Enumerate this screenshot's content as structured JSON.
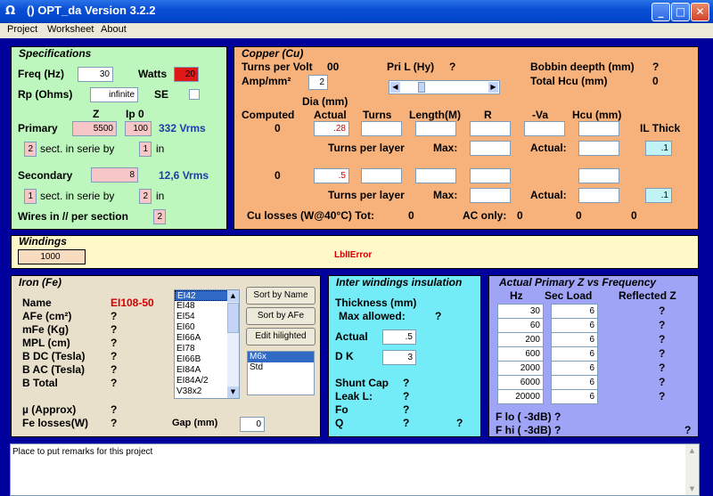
{
  "window": {
    "title": "() OPT_da Version 3.2.2"
  },
  "menu": [
    "Project",
    "Worksheet",
    "About"
  ],
  "spec": {
    "title": "Specifications",
    "freq_label": "Freq (Hz)",
    "freq": "30",
    "watts_label": "Watts",
    "watts": "20",
    "rp_label": "Rp (Ohms)",
    "rp": "infinite",
    "se_label": "SE",
    "z_label": "Z",
    "ip_label": "Ip 0",
    "primary_label": "Primary",
    "primary_z": "5500",
    "primary_ip": "100",
    "primary_vrms": "332 Vrms",
    "sect1": "2",
    "sect_in_serie": "sect. in serie by",
    "by1": "1",
    "in_label": "in",
    "secondary_label": "Secondary",
    "secondary_z": "8",
    "secondary_vrms": "12,6 Vrms",
    "sect2": "1",
    "by2": "2",
    "wires_label": "Wires in // per section",
    "wires": "2"
  },
  "copper": {
    "title": "Copper (Cu)",
    "turns_per_volt": "Turns per Volt",
    "turns_per_volt_val": "00",
    "amp_mm": "Amp/mm²",
    "amp_mm_val": "2",
    "pri_l": "Pri L (Hy)",
    "pri_l_val": "?",
    "bobbin": "Bobbin deepth (mm)",
    "bobbin_val": "?",
    "total_hcu": "Total Hcu (mm)",
    "total_hcu_val": "0",
    "dia": "Dia (mm)",
    "h_computed": "Computed",
    "h_actual": "Actual",
    "h_turns": "Turns",
    "h_length": "Length(M)",
    "h_r": "R",
    "h_va": "-Va",
    "h_hcu": "Hcu (mm)",
    "h_il": "IL Thick",
    "row1_computed": "0",
    "row1_actual": ".28",
    "row1_il": ".1",
    "row2_computed": "0",
    "row2_actual": ".5",
    "row2_il": ".1",
    "tpl": "Turns per layer",
    "max": "Max:",
    "actual": "Actual:",
    "losses": "Cu losses (W@40°C) Tot:",
    "losses_tot": "0",
    "ac_only": "AC only:",
    "ac_val1": "0",
    "ac_val2": "0",
    "ac_val3": "0"
  },
  "windings": {
    "title": "Windings",
    "value": "1000",
    "error": "LblIError"
  },
  "iron": {
    "title": "Iron (Fe)",
    "name_label": "Name",
    "name_val": "EI108-50",
    "afe": "AFe (cm²)",
    "mfe": "mFe (Kg)",
    "mpl": "MPL (cm)",
    "bdc": "B DC (Tesla)",
    "bac": "B AC (Tesla)",
    "btot": "B Total",
    "q": "?",
    "mu": "µ (Approx)",
    "fe_losses": "Fe losses(W)",
    "gap_label": "Gap (mm)",
    "gap": "0",
    "cores": [
      "EI42",
      "EI48",
      "EI54",
      "EI60",
      "EI66A",
      "EI78",
      "EI66B",
      "EI84A",
      "EI84A/2",
      "V38x2"
    ],
    "btn_sort_name": "Sort by Name",
    "btn_sort_afe": "Sort by AFe",
    "btn_edit": "Edit hilighted",
    "materials": [
      "M6x",
      "Std"
    ]
  },
  "insulation": {
    "title": "Inter windings insulation",
    "thickness": "Thickness (mm)",
    "max_allowed": "Max allowed:",
    "max_val": "?",
    "actual_label": "Actual",
    "actual_val": ".5",
    "dk_label": "D K",
    "dk_val": "3",
    "shunt": "Shunt Cap",
    "leak": "Leak L:",
    "fo": "Fo",
    "q_label": "Q",
    "q": "?"
  },
  "freq": {
    "title": "Actual Primary Z vs Frequency",
    "h_hz": "Hz",
    "h_load": "Sec Load",
    "h_refl": "Reflected Z",
    "rows": [
      {
        "hz": "30",
        "load": "6",
        "z": "?"
      },
      {
        "hz": "60",
        "load": "6",
        "z": "?"
      },
      {
        "hz": "200",
        "load": "6",
        "z": "?"
      },
      {
        "hz": "600",
        "load": "6",
        "z": "?"
      },
      {
        "hz": "2000",
        "load": "6",
        "z": "?"
      },
      {
        "hz": "6000",
        "load": "6",
        "z": "?"
      },
      {
        "hz": "20000",
        "load": "6",
        "z": "?"
      }
    ],
    "flo": "F lo ( -3dB) ?",
    "fhi": "F hi ( -3dB) ?",
    "q": "?"
  },
  "remarks": {
    "text": "Place to put remarks for this project"
  }
}
